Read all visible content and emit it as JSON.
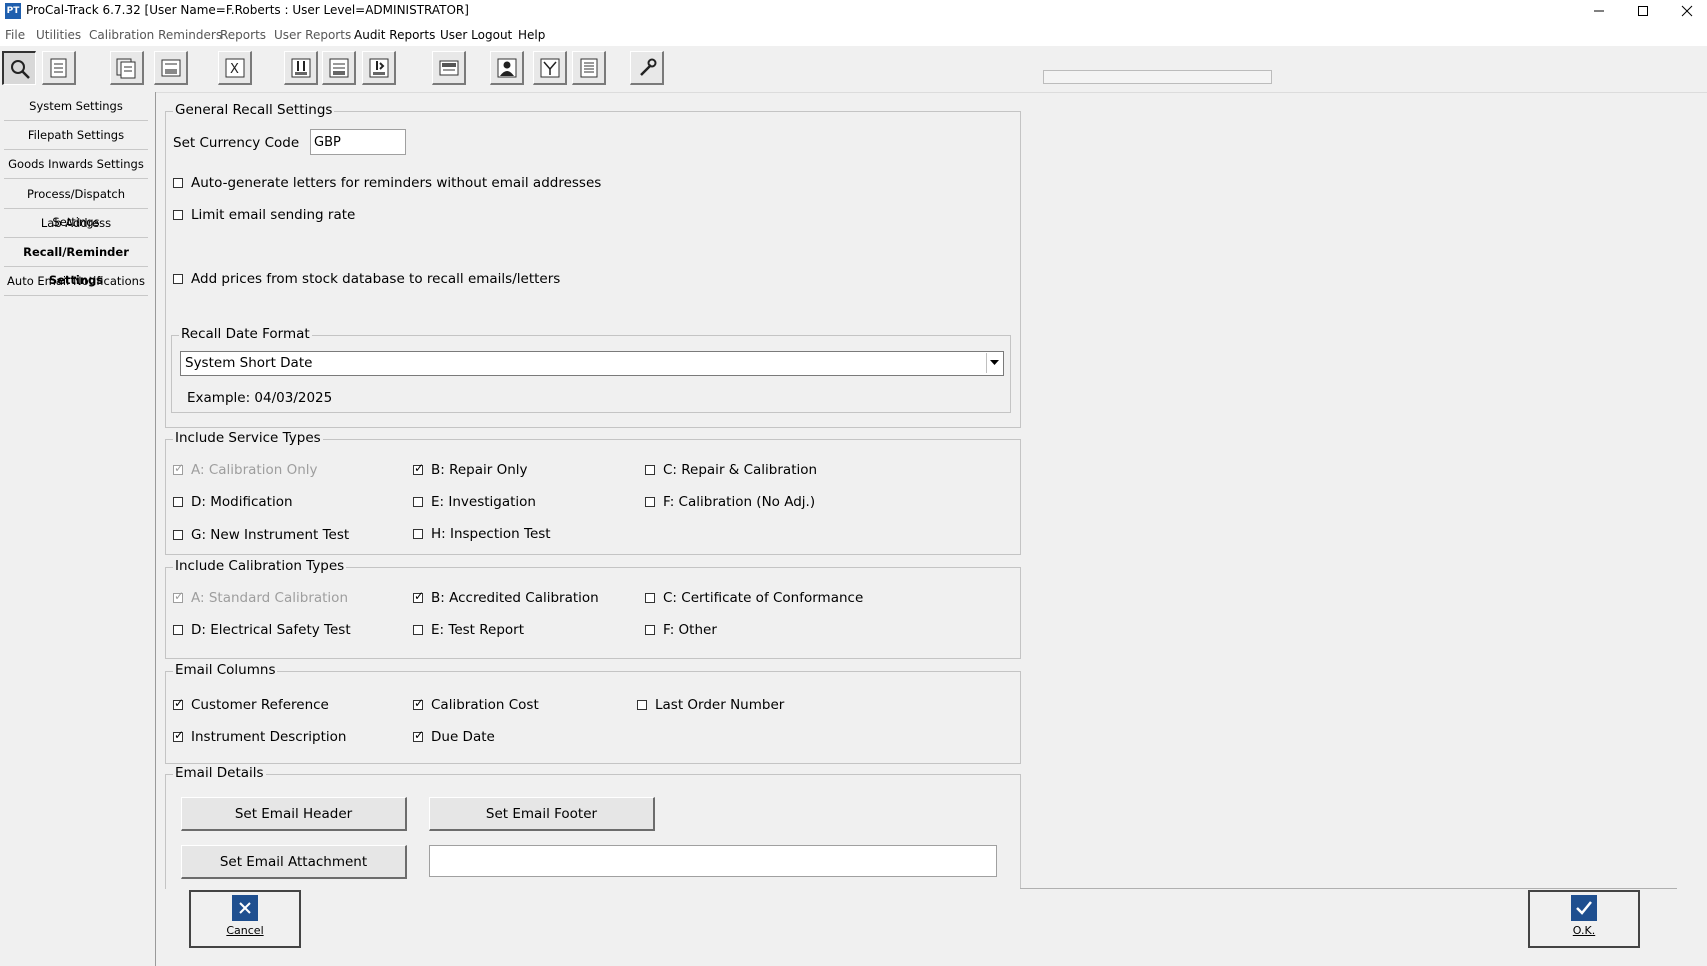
{
  "window": {
    "title": "ProCal-Track 6.7.32 [User Name=F.Roberts : User Level=ADMINISTRATOR]",
    "logo_text": "PT"
  },
  "menu": [
    "File",
    "Utilities",
    "Calibration Reminders",
    "Reports",
    "User Reports",
    "Audit Reports",
    "User Logout",
    "Help"
  ],
  "toolbar": {
    "icons": [
      "search-icon",
      "document-list-icon",
      "multi-page-icon",
      "site-icon",
      "excel-icon",
      "calibration-in-icon",
      "calibration-out-icon",
      "goods-in-icon",
      "certificate-icon",
      "user-icon",
      "filter-icon",
      "report-list-icon",
      "settings-tools-icon"
    ]
  },
  "sidebar": {
    "items": [
      {
        "label": "System Settings"
      },
      {
        "label": "Filepath Settings"
      },
      {
        "label": "Goods Inwards Settings"
      },
      {
        "label": "Process/Dispatch Settings"
      },
      {
        "label": "Lab Address"
      },
      {
        "label": "Recall/Reminder Settings"
      },
      {
        "label": "Auto Email Notifications"
      }
    ],
    "active_index": 5
  },
  "general": {
    "title": "General Recall Settings",
    "currency_label": "Set Currency Code",
    "currency_value": "GBP",
    "auto_generate_label": "Auto-generate letters for reminders without email addresses",
    "auto_generate_checked": false,
    "limit_rate_label": "Limit email sending rate",
    "limit_rate_checked": false,
    "add_prices_label": "Add prices from stock database to recall emails/letters",
    "add_prices_checked": false,
    "date_format": {
      "title": "Recall Date Format",
      "selected": "System Short Date",
      "example": "Example: 04/03/2025"
    }
  },
  "service_types": {
    "title": "Include Service Types",
    "items": [
      {
        "label": "A: Calibration Only",
        "checked": true,
        "disabled": true
      },
      {
        "label": "B: Repair Only",
        "checked": true,
        "disabled": false
      },
      {
        "label": "C: Repair & Calibration",
        "checked": false,
        "disabled": false
      },
      {
        "label": "D: Modification",
        "checked": false,
        "disabled": false
      },
      {
        "label": "E: Investigation",
        "checked": false,
        "disabled": false
      },
      {
        "label": "F: Calibration (No Adj.)",
        "checked": false,
        "disabled": false
      },
      {
        "label": "G: New Instrument Test",
        "checked": false,
        "disabled": false
      },
      {
        "label": "H: Inspection Test",
        "checked": false,
        "disabled": false
      }
    ]
  },
  "calibration_types": {
    "title": "Include Calibration Types",
    "items": [
      {
        "label": "A: Standard Calibration",
        "checked": true,
        "disabled": true
      },
      {
        "label": "B: Accredited Calibration",
        "checked": true,
        "disabled": false
      },
      {
        "label": "C: Certificate of Conformance",
        "checked": false,
        "disabled": false
      },
      {
        "label": "D: Electrical Safety Test",
        "checked": false,
        "disabled": false
      },
      {
        "label": "E: Test Report",
        "checked": false,
        "disabled": false
      },
      {
        "label": "F: Other",
        "checked": false,
        "disabled": false
      }
    ]
  },
  "email_columns": {
    "title": "Email Columns",
    "items": [
      {
        "label": "Customer Reference",
        "checked": true
      },
      {
        "label": "Calibration Cost",
        "checked": true
      },
      {
        "label": "Last Order Number",
        "checked": false
      },
      {
        "label": "Instrument Description",
        "checked": true
      },
      {
        "label": "Due Date",
        "checked": true
      }
    ]
  },
  "email_details": {
    "title": "Email Details",
    "header_button": "Set Email Header",
    "footer_button": "Set Email Footer",
    "attachment_button": "Set Email Attachment",
    "attachment_value": ""
  },
  "actions": {
    "cancel_label": "Cancel",
    "ok_label": "O.K."
  },
  "colors": {
    "accent": "#1f4f8f",
    "background": "#f0f0f0"
  }
}
